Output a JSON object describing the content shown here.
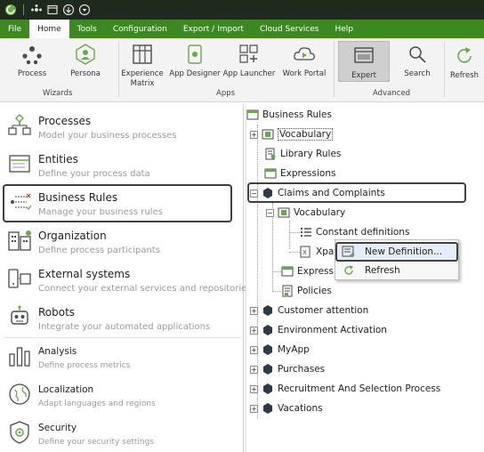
{
  "titlebar": {
    "icons": [
      "app-logo-icon",
      "share-icon",
      "window-icon",
      "upload-icon",
      "dropdown-icon"
    ]
  },
  "menu": {
    "items": [
      "File",
      "Home",
      "Tools",
      "Configuration",
      "Export / Import",
      "Cloud Services",
      "Help"
    ],
    "active": "Home"
  },
  "ribbon": {
    "process": "Process",
    "persona": "Persona",
    "experience_matrix_line1": "Experience",
    "experience_matrix_line2": "Matrix",
    "app_designer": "App Designer",
    "app_launcher": "App Launcher",
    "work_portal": "Work Portal",
    "expert": "Expert",
    "search": "Search",
    "refresh": "Refresh",
    "group_wizards": "Wizards",
    "group_apps": "Apps",
    "group_advanced": "Advanced"
  },
  "nav": [
    {
      "title": "Processes",
      "subtitle": "Model your business processes",
      "icon": "processes-icon"
    },
    {
      "title": "Entities",
      "subtitle": "Define your process data",
      "icon": "entities-icon"
    },
    {
      "title": "Business  Rules",
      "subtitle": "Manage your business rules",
      "icon": "business-rules-icon"
    },
    {
      "title": "Organization",
      "subtitle": "Define process participants",
      "icon": "organization-icon"
    },
    {
      "title": "External systems",
      "subtitle": "Connect your external services and repositories",
      "icon": "external-systems-icon"
    },
    {
      "title": "Robots",
      "subtitle": "Integrate your automated applications",
      "icon": "robots-icon"
    },
    {
      "title": "Analysis",
      "subtitle": "Define process metrics",
      "icon": "analysis-icon"
    },
    {
      "title": "Localization",
      "subtitle": "Adapt languages and regions",
      "icon": "localization-icon"
    },
    {
      "title": "Security",
      "subtitle": "Define your security settings",
      "icon": "security-icon"
    }
  ],
  "tree": {
    "root": "Business Rules",
    "vocabulary": "Vocabulary",
    "library_rules": "Library Rules",
    "expressions": "Expressions",
    "claims": "Claims and Complaints",
    "claims_vocabulary": "Vocabulary",
    "constant_definitions": "Constant definitions",
    "xpath_partial": "Xpat",
    "claims_expressions_partial": "Expressi",
    "policies": "Policies",
    "apps": [
      "Customer attention",
      "Environment Activation",
      "MyApp",
      "Purchases",
      "Recruitment And Selection Process",
      "Vacations"
    ]
  },
  "context_menu": {
    "new_definition": "New Definition...",
    "refresh": "Refresh"
  },
  "colors": {
    "menubar": "#3b8a21",
    "titlebar": "#1e2a1b",
    "accent_green": "#6aa84f"
  }
}
